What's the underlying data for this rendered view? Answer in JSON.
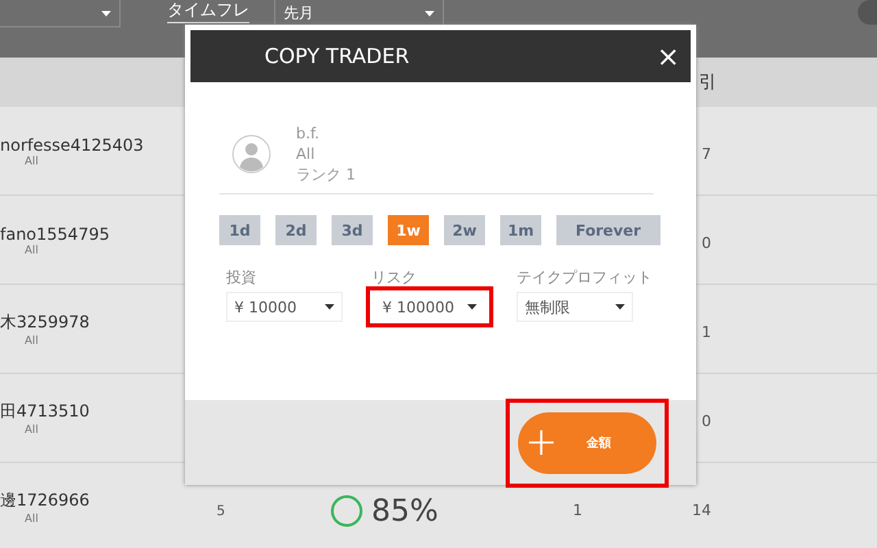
{
  "top_bar": {
    "timeframe_label": "タイムフレ",
    "timeframe_select": "先月"
  },
  "table": {
    "column_5_header": "引",
    "rows": [
      {
        "trader": "norfesse4125403",
        "subtitle": "All",
        "column_5": "7"
      },
      {
        "trader": "fano1554795",
        "subtitle": "All",
        "column_5": "0"
      },
      {
        "trader": "木3259978",
        "subtitle": "All",
        "column_5": "1"
      },
      {
        "trader": "田4713510",
        "subtitle": "All",
        "column_5": "0"
      },
      {
        "trader": "邊1726966",
        "subtitle": "All",
        "column_2": "5",
        "column_3": "85%",
        "column_4": "1",
        "column_5": "14"
      }
    ]
  },
  "modal": {
    "title": "COPY TRADER",
    "close": "×",
    "profile": {
      "name": "b.f.",
      "market": "All",
      "rank": "ランク 1"
    },
    "periods": [
      {
        "label": "1d",
        "selected": false
      },
      {
        "label": "2d",
        "selected": false
      },
      {
        "label": "3d",
        "selected": false
      },
      {
        "label": "1w",
        "selected": true
      },
      {
        "label": "2w",
        "selected": false
      },
      {
        "label": "1m",
        "selected": false
      },
      {
        "label": "Forever",
        "selected": false
      }
    ],
    "fields": [
      {
        "label": "投資",
        "value": "¥ 10000",
        "highlighted": false
      },
      {
        "label": "リスク",
        "value": "¥ 100000",
        "highlighted": true
      },
      {
        "label": "テイクプロフィット",
        "value": "無制限",
        "highlighted": false
      }
    ],
    "action_button": {
      "label": "金額",
      "highlighted": true
    }
  }
}
